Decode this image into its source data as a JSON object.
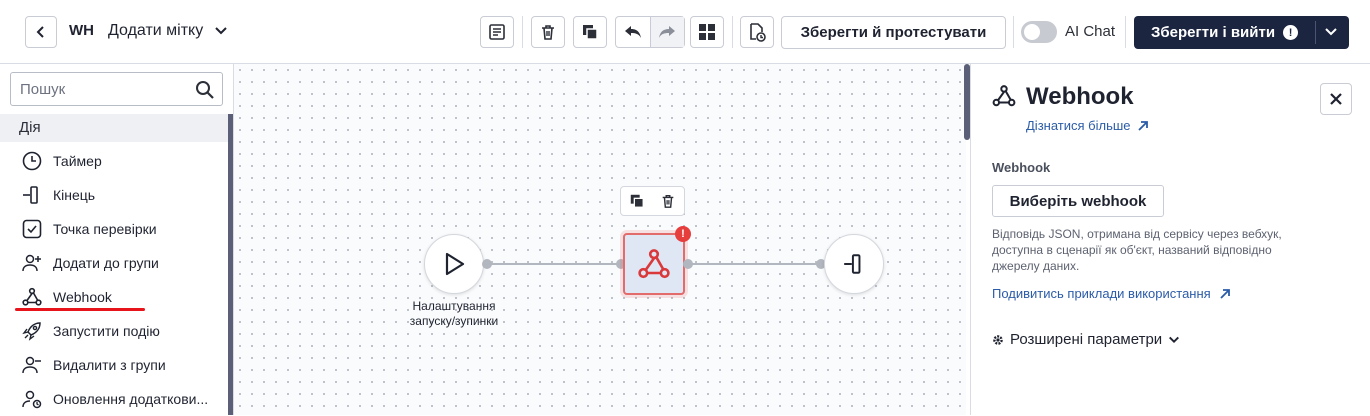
{
  "header": {
    "flow_short": "WH",
    "flow_name": "Додати мітку",
    "save_test_label": "Зберегти й протестувати",
    "ai_chat_label": "AI Chat",
    "ai_chat_enabled": false,
    "save_exit_label": "Зберегти і вийти",
    "save_exit_warning": "!"
  },
  "sidebar": {
    "search_placeholder": "Пошук",
    "section_title": "Дія",
    "items": [
      {
        "label": "Таймер",
        "icon": "timer-icon"
      },
      {
        "label": "Кінець",
        "icon": "end-icon"
      },
      {
        "label": "Точка перевірки",
        "icon": "checkpoint-icon"
      },
      {
        "label": "Додати до групи",
        "icon": "add-to-group-icon"
      },
      {
        "label": "Webhook",
        "icon": "webhook-icon",
        "highlighted": true
      },
      {
        "label": "Запустити подію",
        "icon": "rocket-icon"
      },
      {
        "label": "Видалити з групи",
        "icon": "remove-from-group-icon"
      },
      {
        "label": "Оновлення додаткови...",
        "icon": "update-attributes-icon"
      }
    ]
  },
  "canvas": {
    "start_node_caption": "Налаштування запуску/зупинки",
    "webhook_node_alert": "!"
  },
  "panel": {
    "title": "Webhook",
    "learn_more": "Дізнатися більше",
    "field_label": "Webhook",
    "choose_button": "Виберіть webhook",
    "help_text": "Відповідь JSON, отримана від сервісу через вебхук, доступна в сценарії як об'єкт, названий відповідно джерелу даних.",
    "examples_link": "Подивитись приклади використання",
    "advanced_label": "Розширені параметри"
  },
  "colors": {
    "primary_dark": "#1c2540",
    "link": "#2b5ca8",
    "error": "#e63d3d",
    "highlight_underline": "#e8141c"
  }
}
